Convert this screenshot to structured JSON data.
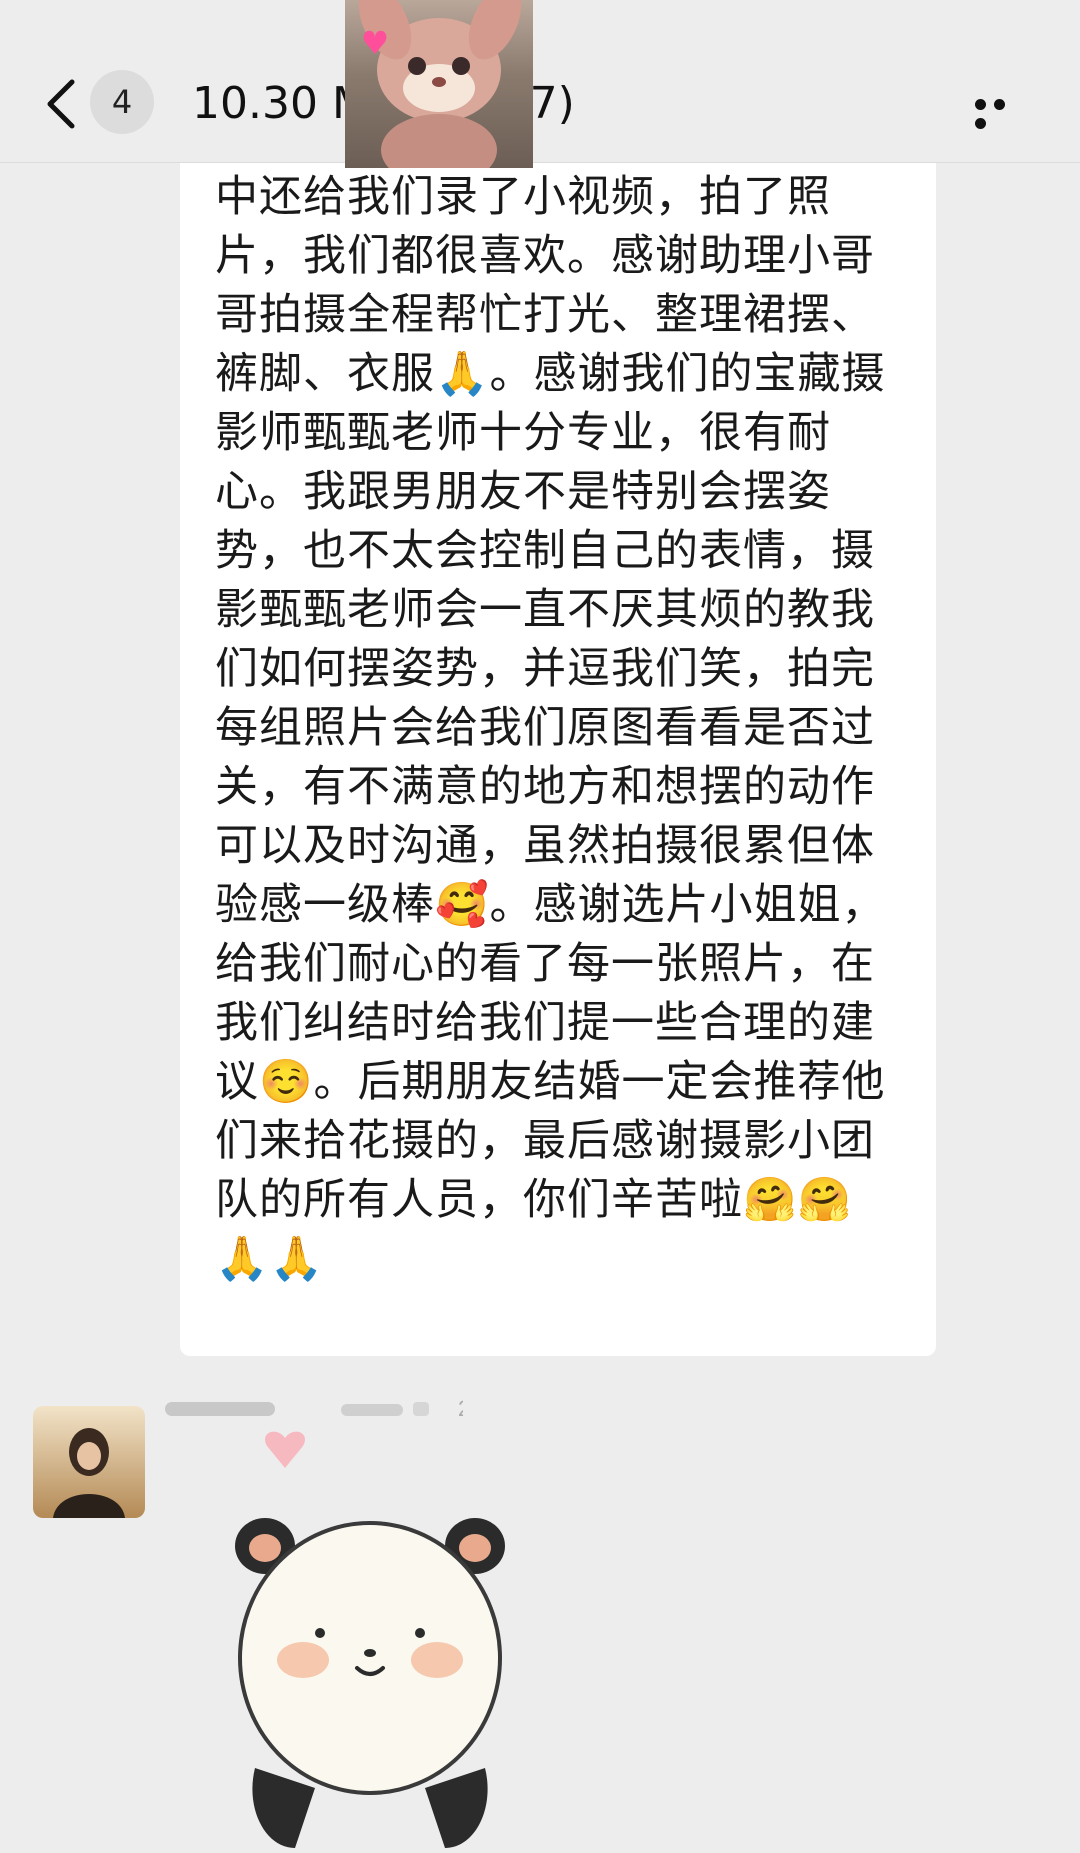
{
  "header": {
    "unread_count": "4",
    "title": "10.30 MVP沟...(7)"
  },
  "message": {
    "text": "中还给我们录了小视频，拍了照片，我们都很喜欢。感谢助理小哥哥拍摄全程帮忙打光、整理裙摆、裤脚、衣服🙏。感谢我们的宝藏摄影师甄甄老师十分专业，很有耐心。我跟男朋友不是特别会摆姿势，也不太会控制自己的表情，摄影甄甄老师会一直不厌其烦的教我们如何摆姿势，并逗我们笑，拍完每组照片会给我们原图看看是否过关，有不满意的地方和想摆的动作可以及时沟通，虽然拍摄很累但体验感一级棒🥰。感谢选片小姐姐，给我们耐心的看了每一张照片，在我们纠结时给我们提一些合理的建议☺️。后期朋友结婚一定会推荐他们来拾花摄的，最后感谢摄影小团队的所有人员，你们辛苦啦🤗🤗🙏🙏"
  },
  "second_message": {
    "sticker": "panda-heart-sticker"
  },
  "icons": {
    "back": "chevron-left-icon",
    "more": "more-dots-icon"
  }
}
